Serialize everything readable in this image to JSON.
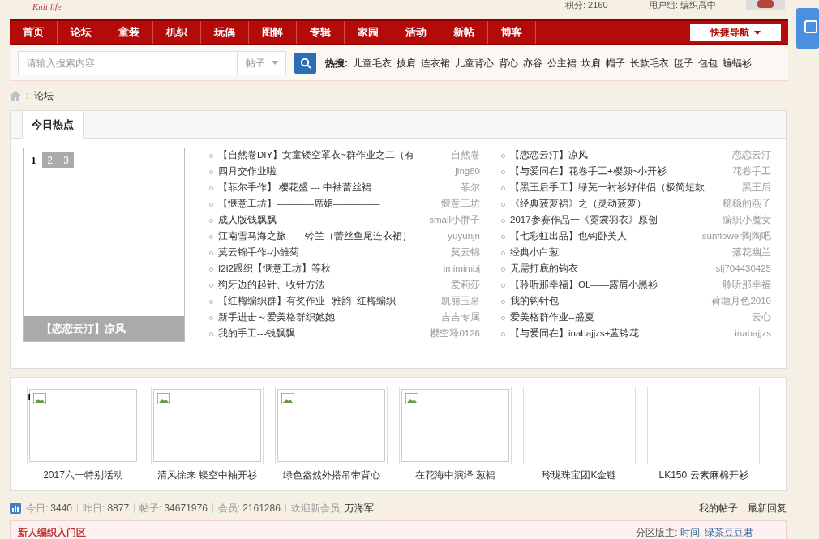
{
  "logo": {
    "text": "Knit life"
  },
  "user_bar": {
    "points": "积分: 2160",
    "group": "用户组: 编织高中"
  },
  "nav": {
    "items": [
      {
        "label": "首页"
      },
      {
        "label": "论坛"
      },
      {
        "label": "童装"
      },
      {
        "label": "机织"
      },
      {
        "label": "玩偶"
      },
      {
        "label": "图解"
      },
      {
        "label": "专辑"
      },
      {
        "label": "家园"
      },
      {
        "label": "活动"
      },
      {
        "label": "新帖"
      },
      {
        "label": "博客"
      }
    ],
    "quick_nav": "快捷导航"
  },
  "search": {
    "placeholder": "请输入搜索内容",
    "scope": "帖子",
    "hot_label": "热搜:",
    "hot_words": [
      "儿童毛衣",
      "披肩",
      "连衣裙",
      "儿童背心",
      "背心",
      "亦谷",
      "公主裙",
      "坎肩",
      "帽子",
      "长款毛衣",
      "毯子",
      "包包",
      "蝙蝠衫"
    ]
  },
  "breadcrumb": {
    "current": "论坛"
  },
  "hot": {
    "tab": "今日热点",
    "slider": {
      "pages": [
        {
          "label": "1",
          "selected": true
        },
        {
          "label": "2",
          "selected": false
        },
        {
          "label": "3",
          "selected": false
        }
      ],
      "caption": "【恋恋云汀】凉风"
    },
    "columns": [
      [
        {
          "title": "【自然卷DIY】女童镂空罩衣~群作业之二（有",
          "author": "自然卷"
        },
        {
          "title": "四月交作业啦",
          "author": "jing80"
        },
        {
          "title": "【菲尔手作】 樱花盛 --- 中袖蕾丝裙",
          "author": "菲尔"
        },
        {
          "title": "【惬意工坊】————席娟—————",
          "author": "惬意工坊"
        },
        {
          "title": "成人版钱飘飘",
          "author": "small小胖子"
        },
        {
          "title": "江南雪马海之旅——铃兰（蕾丝鱼尾连衣裙）",
          "author": "yuyunjn"
        },
        {
          "title": "莫云锦手作-小雏菊",
          "author": "莫云锦"
        },
        {
          "title": "I2I2跟织【惬意工坊】等秋",
          "author": "imimimbj"
        },
        {
          "title": "狗牙边的起针、收针方法",
          "author": "爱莉莎"
        },
        {
          "title": "【红梅编织群】有奖作业--雅韵--红梅编织",
          "author": "凯丽玉帛"
        },
        {
          "title": "新手进击～爱美格群织她她",
          "author": "吉吉专属"
        },
        {
          "title": "我的手工---钱飘飘",
          "author": "樱空释0126"
        }
      ],
      [
        {
          "title": "【恋恋云汀】凉风",
          "author": "恋恋云汀"
        },
        {
          "title": "【与爱同在】花卷手工+樱颜~小开衫",
          "author": "花卷手工"
        },
        {
          "title": "【黑王后手工】绿芜一衬衫好伴侣（极简短款",
          "author": "黑王后"
        },
        {
          "title": "《经典菠萝裙》之（灵动菠萝）",
          "author": "稳稳的燕子"
        },
        {
          "title": "2017参赛作品一《霓裳羽衣》原创",
          "author": "编织小魔女"
        },
        {
          "title": "【七彩虹出品】也钩卧美人",
          "author": "sunflower陶陶吧"
        },
        {
          "title": "经典小白葱",
          "author": "落花幽兰"
        },
        {
          "title": "无需打底的钩衣",
          "author": "slj704430425"
        },
        {
          "title": "【聆听那幸福】OL——露肩小黑衫",
          "author": "聆听那幸福"
        },
        {
          "title": "我的钩针包",
          "author": "荷塘月色2010"
        },
        {
          "title": "爱美格群作业--盛夏",
          "author": "云心"
        },
        {
          "title": "【与爱同在】inabajjzs+蓝铃花",
          "author": "inabajjzs"
        }
      ]
    ]
  },
  "gallery": {
    "badge": "1",
    "items": [
      {
        "caption": "2017六一特别活动",
        "broken": true
      },
      {
        "caption": "清风徐来 镂空中袖开衫",
        "broken": true
      },
      {
        "caption": "绿色盎然外搭吊带背心",
        "broken": true
      },
      {
        "caption": "在花海中演绎 葱裙",
        "broken": true
      },
      {
        "caption": "玲珑珠宝团K金链",
        "broken": false
      },
      {
        "caption": "LK150 云素麻棉开衫",
        "broken": false
      }
    ]
  },
  "stats": {
    "items": [
      {
        "label": "今日:",
        "value": "3440"
      },
      {
        "label": "昨日:",
        "value": "8877"
      },
      {
        "label": "帖子:",
        "value": "34671976"
      },
      {
        "label": "会员:",
        "value": "2161286"
      }
    ],
    "welcome_label": "欢迎新会员:",
    "new_member": "万海军",
    "links": [
      "我的帖子",
      "最新回复"
    ]
  },
  "section": {
    "title": "新人编织入门区",
    "moderator_label": "分区版主:",
    "moderators": [
      "时间",
      "绿茶豆豆君"
    ],
    "separator": ","
  }
}
